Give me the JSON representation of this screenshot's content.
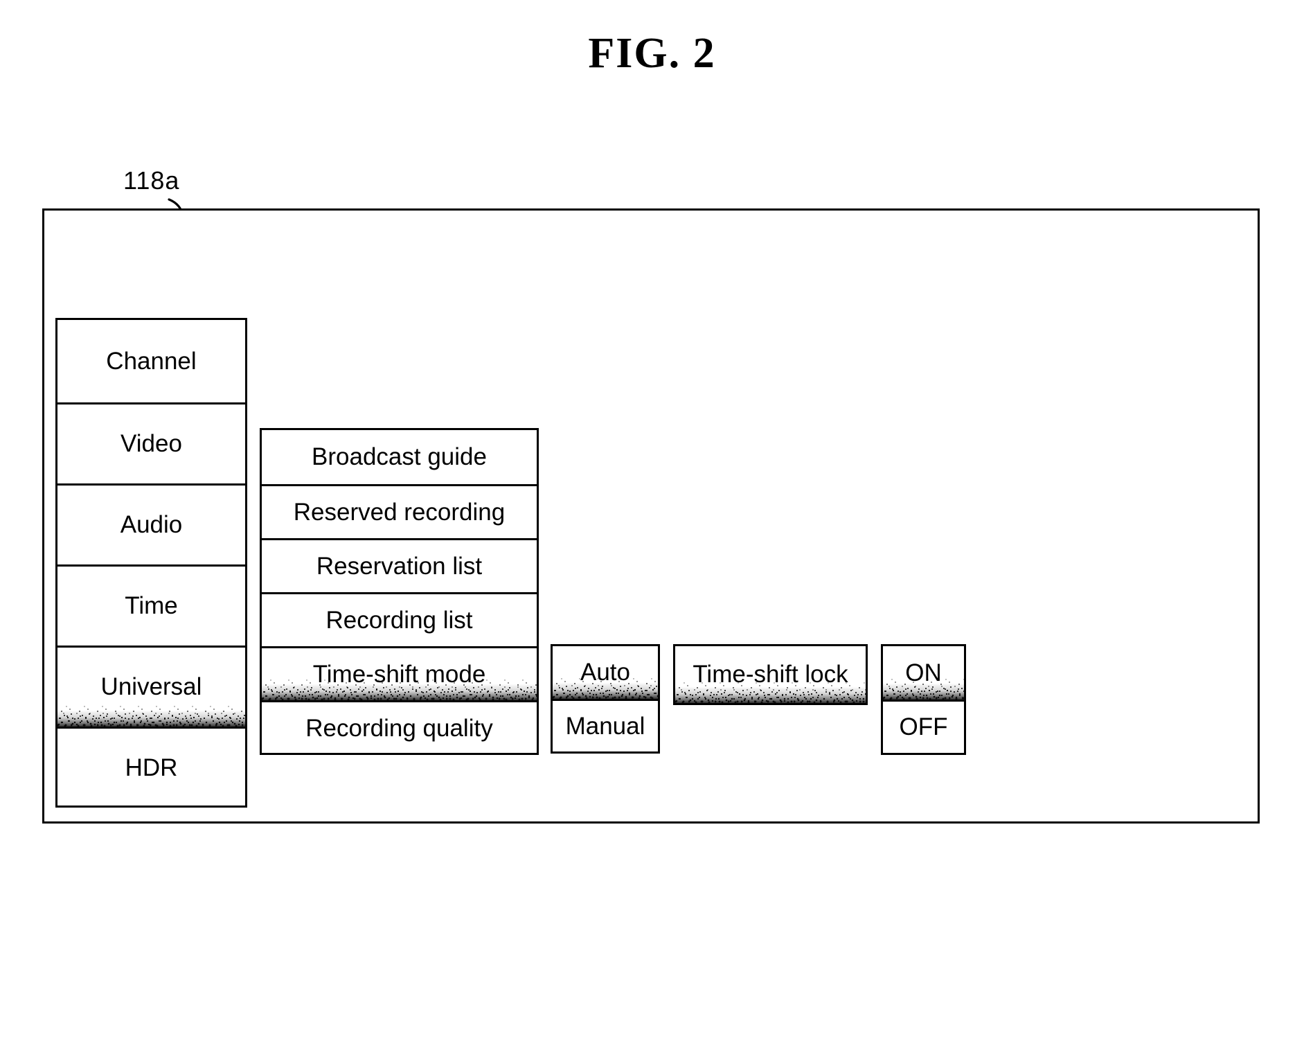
{
  "figure": {
    "title": "FIG. 2",
    "reference_numeral": "118a"
  },
  "screen": {
    "name": "osd-menu-screen"
  },
  "menus": {
    "main_menu": {
      "name": "main-menu-column",
      "items": [
        {
          "label": "Channel",
          "highlighted": false
        },
        {
          "label": "Video",
          "highlighted": false
        },
        {
          "label": "Audio",
          "highlighted": false
        },
        {
          "label": "Time",
          "highlighted": false
        },
        {
          "label": "Universal",
          "highlighted": true
        },
        {
          "label": "HDR",
          "highlighted": false
        }
      ]
    },
    "sub_menu": {
      "name": "recording-submenu-column",
      "items": [
        {
          "label": "Broadcast guide",
          "highlighted": false
        },
        {
          "label": "Reserved recording",
          "highlighted": false
        },
        {
          "label": "Reservation list",
          "highlighted": false
        },
        {
          "label": "Recording list",
          "highlighted": false
        },
        {
          "label": "Time-shift mode",
          "highlighted": true
        },
        {
          "label": "Recording quality",
          "highlighted": false
        }
      ]
    },
    "mode_menu": {
      "name": "time-shift-mode-options",
      "items": [
        {
          "label": "Auto",
          "highlighted": true
        },
        {
          "label": "Manual",
          "highlighted": false
        }
      ]
    },
    "lock_menu": {
      "name": "time-shift-lock-option",
      "items": [
        {
          "label": "Time-shift lock",
          "highlighted": true
        }
      ]
    },
    "onoff_menu": {
      "name": "time-shift-lock-onoff-options",
      "items": [
        {
          "label": "ON",
          "highlighted": true
        },
        {
          "label": "OFF",
          "highlighted": false
        }
      ]
    }
  },
  "colors": {
    "ink": "#000000",
    "paper": "#ffffff"
  }
}
